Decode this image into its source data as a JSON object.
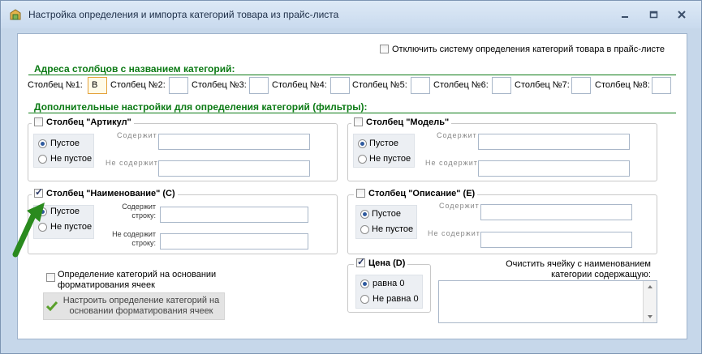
{
  "window": {
    "title": "Настройка определения и импорта категорий товара из прайс-листа"
  },
  "disable_system": {
    "label": "Отключить систему определения категорий товара в прайс-листе",
    "checked": false
  },
  "columns_section": {
    "header": "Адреса столбцов с названием категорий:",
    "fields": [
      {
        "label": "Столбец №1:",
        "value": "В"
      },
      {
        "label": "Столбец №2:",
        "value": ""
      },
      {
        "label": "Столбец №3:",
        "value": ""
      },
      {
        "label": "Столбец №4:",
        "value": ""
      },
      {
        "label": "Столбец №5:",
        "value": ""
      },
      {
        "label": "Столбец №6:",
        "value": ""
      },
      {
        "label": "Столбец №7:",
        "value": ""
      },
      {
        "label": "Столбец №8:",
        "value": ""
      }
    ]
  },
  "filters_section": {
    "header": "Дополнительные настройки для определения категорий (фильтры):"
  },
  "groups": {
    "artikul": {
      "title": "Столбец \"Артикул\"",
      "checked": false,
      "opt_empty": "Пустое",
      "opt_not_empty": "Не пустое",
      "contains": "Содержит",
      "not_contains": "Не содержит"
    },
    "model": {
      "title": "Столбец \"Модель\"",
      "checked": false,
      "opt_empty": "Пустое",
      "opt_not_empty": "Не пустое",
      "contains": "Содержит",
      "not_contains": "Не содержит"
    },
    "name": {
      "title": "Столбец \"Наименование\" (С)",
      "checked": true,
      "opt_empty": "Пустое",
      "opt_not_empty": "Не пустое",
      "contains": "Содержит строку:",
      "not_contains": "Не содержит строку:"
    },
    "desc": {
      "title": "Столбец \"Описание\" (Е)",
      "checked": false,
      "opt_empty": "Пустое",
      "opt_not_empty": "Не пустое",
      "contains": "Содержит",
      "not_contains": "Не содержит"
    },
    "price": {
      "title": "Цена (D)",
      "checked": true,
      "opt_eq": "равна 0",
      "opt_neq": "Не равна 0"
    }
  },
  "format_def": {
    "label": "Определение категорий на основании форматирования ячеек",
    "checked": false
  },
  "format_btn": {
    "label": "Настроить определение категорий на основании форматирования ячеек"
  },
  "clear_cell": {
    "label": "Очистить ячейку с наименованием категории содержащую:"
  },
  "colors": {
    "accent": "#0b7a14",
    "arrow": "#2a8a1e"
  }
}
